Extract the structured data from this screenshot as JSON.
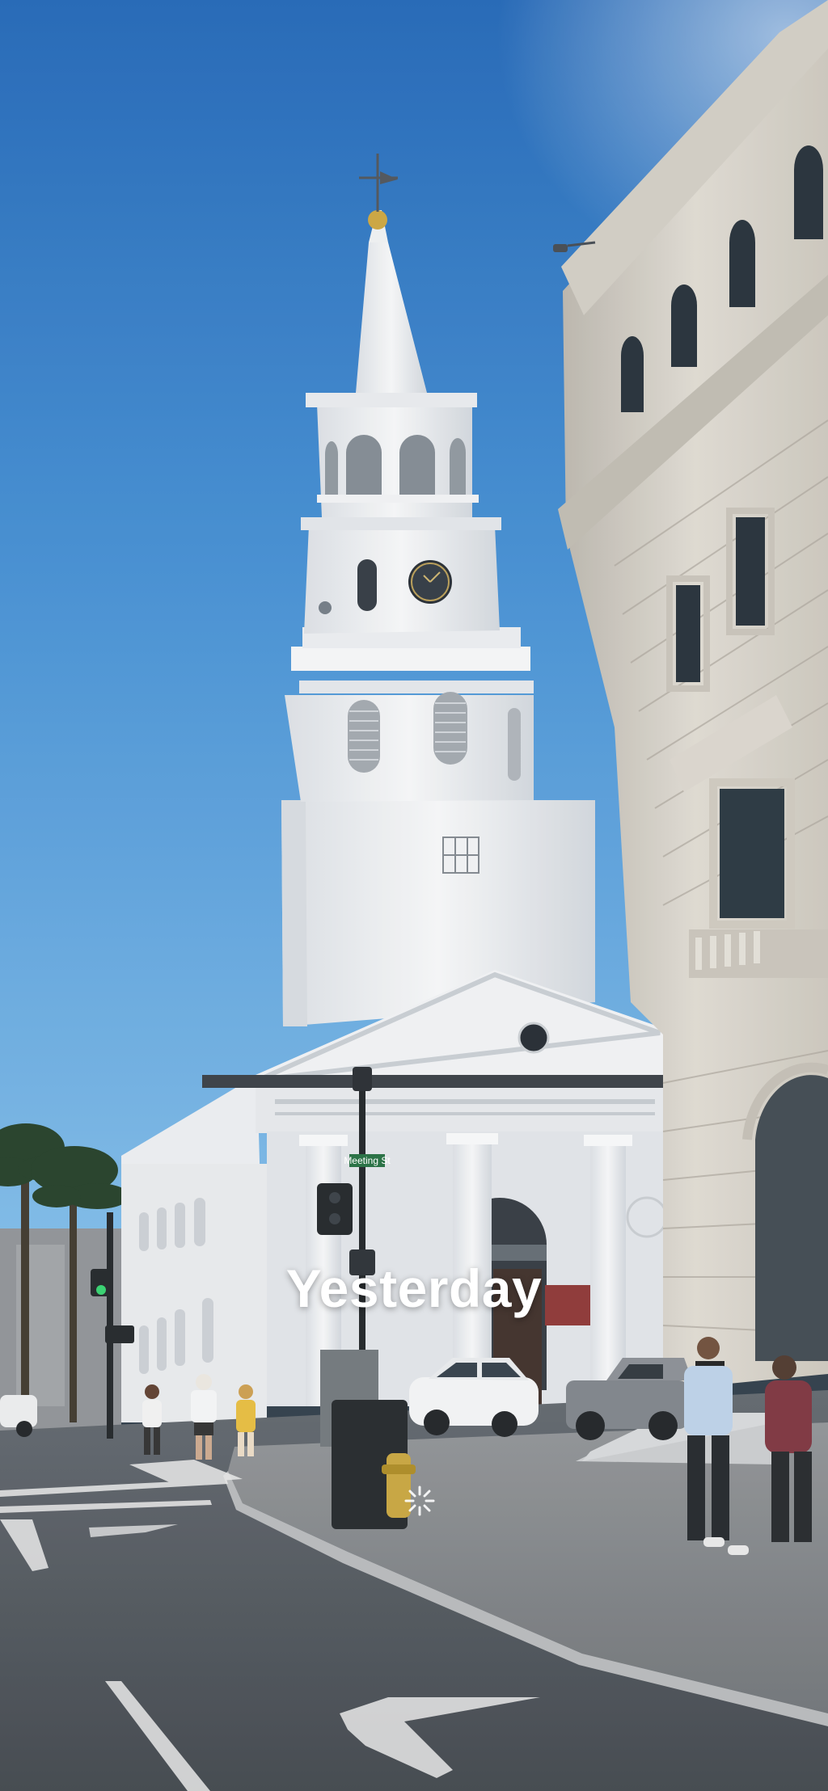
{
  "memory": {
    "caption": "Yesterday"
  },
  "photo": {
    "street_sign_text": "Meeting St",
    "sky_color_top": "#1a5fb0",
    "sky_color_bottom": "#5ba3dc",
    "steeple_color": "#eef0f1",
    "building_color": "#d6d1c6"
  },
  "icons": {
    "live_indicator": "sparkle-icon"
  }
}
